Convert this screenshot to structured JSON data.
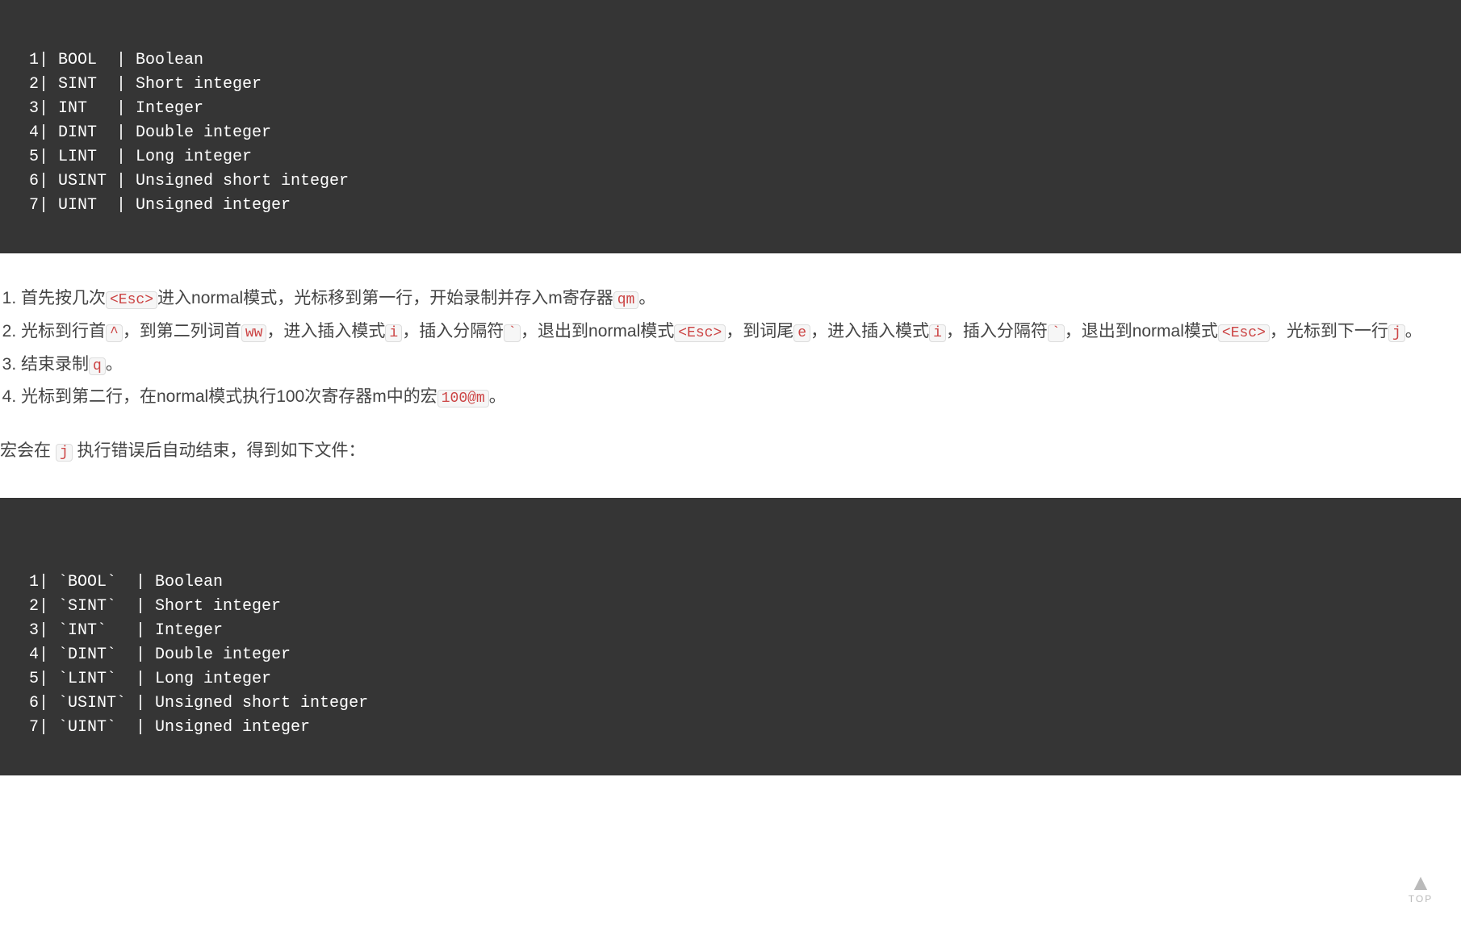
{
  "codeBlock1": {
    "rows": [
      {
        "n": "1",
        "text": "| BOOL  | Boolean"
      },
      {
        "n": "2",
        "text": "| SINT  | Short integer"
      },
      {
        "n": "3",
        "text": "| INT   | Integer"
      },
      {
        "n": "4",
        "text": "| DINT  | Double integer"
      },
      {
        "n": "5",
        "text": "| LINT  | Long integer"
      },
      {
        "n": "6",
        "text": "| USINT | Unsigned short integer"
      },
      {
        "n": "7",
        "text": "| UINT  | Unsigned integer"
      }
    ]
  },
  "steps": {
    "s1": {
      "p0": "首先按几次",
      "k0": "<Esc>",
      "p1": "进入normal模式，光标移到第一行，开始录制并存入m寄存器",
      "k1": "qm",
      "p2": "。"
    },
    "s2": {
      "p0": "光标到行首",
      "k0": "^",
      "p1": "，到第二列词首",
      "k1": "ww",
      "p2": "，进入插入模式",
      "k2": "i",
      "p3": "，插入分隔符",
      "k3": "`",
      "p4": "，退出到normal模式",
      "k4": "<Esc>",
      "p5": "，到词尾",
      "k5": "e",
      "p6": "，进入插入模式",
      "k6": "i",
      "p7": "，插入分隔符",
      "k7": "`",
      "p8": "，退出到normal模式",
      "k8": "<Esc>",
      "p9": "，光标到下一行",
      "k9": "j",
      "p10": "。"
    },
    "s3": {
      "p0": "结束录制",
      "k0": "q",
      "p1": "。"
    },
    "s4": {
      "p0": "光标到第二行，在normal模式执行100次寄存器m中的宏",
      "k0": "100@m",
      "p1": "。"
    }
  },
  "afterParagraph": {
    "p0": "宏会在 ",
    "k0": "j",
    "p1": " 执行错误后自动结束，得到如下文件："
  },
  "codeBlock2": {
    "rows": [
      {
        "n": "1",
        "text": "| `BOOL`  | Boolean"
      },
      {
        "n": "2",
        "text": "| `SINT`  | Short integer"
      },
      {
        "n": "3",
        "text": "| `INT`   | Integer"
      },
      {
        "n": "4",
        "text": "| `DINT`  | Double integer"
      },
      {
        "n": "5",
        "text": "| `LINT`  | Long integer"
      },
      {
        "n": "6",
        "text": "| `USINT` | Unsigned short integer"
      },
      {
        "n": "7",
        "text": "| `UINT`  | Unsigned integer"
      }
    ]
  },
  "topButton": {
    "arrow": "▲",
    "label": "TOP"
  }
}
